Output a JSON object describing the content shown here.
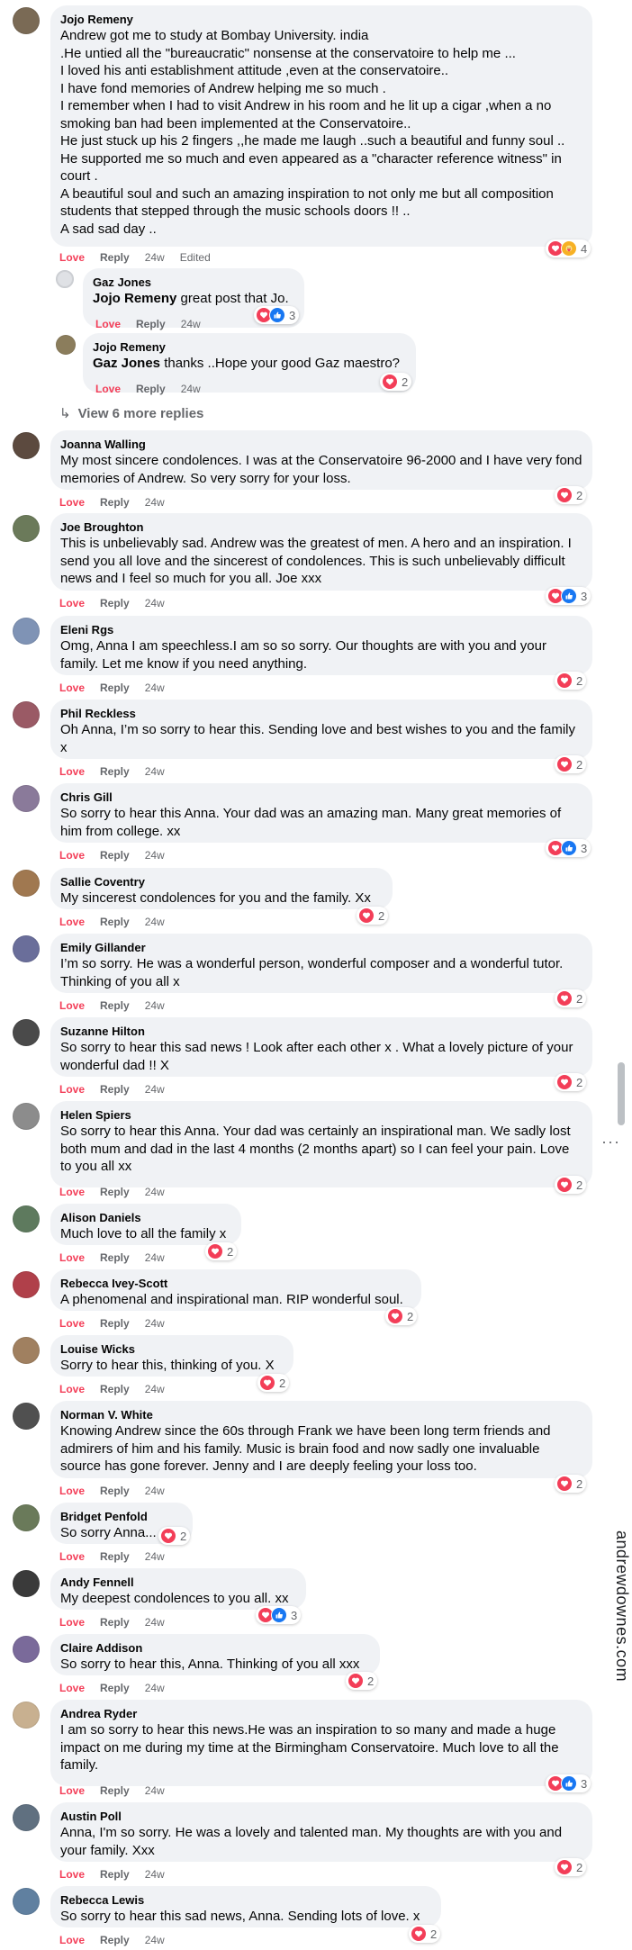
{
  "actions": {
    "love": "Love",
    "reply": "Reply"
  },
  "more_replies": "View 6 more replies",
  "watermark": "andrewdownes.com",
  "comments": [
    {
      "name": "Jojo Remeny",
      "text": "Andrew got me to study at Bombay University. india\n.He untied all the \"bureaucratic\" nonsense at the conservatoire to help me ...\nI loved his anti establishment attitude ,even at the conservatoire..\nI have fond memories of Andrew helping me so much .\nI remember when I had to visit Andrew in his room and he lit up a cigar ,when a no smoking ban had been implemented at the Conservatoire..\nHe just stuck up his 2 fingers ,,he made me laugh ..such a beautiful and funny soul ..\nHe supported me so much and even appeared as a \"character reference witness\" in court .\nA beautiful soul and such an amazing inspiration to not only me but all composition students that stepped through the music schools doors !! ..\nA sad sad day ..",
      "time": "24w",
      "edited": "Edited",
      "count": "4",
      "reactions": [
        "love",
        "care"
      ]
    },
    {
      "name": "Gaz Jones",
      "tag": "Jojo Remeny",
      "text": " great post that Jo.",
      "time": "24w",
      "count": "3",
      "reactions": [
        "love",
        "like"
      ]
    },
    {
      "name": "Jojo Remeny",
      "tag": "Gaz Jones",
      "text": " thanks ..Hope your good Gaz maestro?",
      "time": "24w",
      "count": "2",
      "reactions": [
        "love"
      ]
    },
    {
      "name": "Joanna Walling",
      "text": "My most sincere condolences. I was at the Conservatoire 96-2000 and I have very fond memories of Andrew. So very sorry for your loss.",
      "time": "24w",
      "count": "2",
      "reactions": [
        "love"
      ]
    },
    {
      "name": "Joe Broughton",
      "text": "This is unbelievably sad. Andrew was the greatest of men. A hero and an inspiration. I send you all love and the sincerest of condolences. This is such unbelievably difficult news and I feel so much for you all. Joe xxx",
      "time": "24w",
      "count": "3",
      "reactions": [
        "love",
        "like"
      ]
    },
    {
      "name": "Eleni Rgs",
      "text": "Omg, Anna I am speechless.I am so so sorry. Our thoughts are with you and your family. Let me know if you need anything.",
      "time": "24w",
      "count": "2",
      "reactions": [
        "love"
      ]
    },
    {
      "name": "Phil Reckless",
      "text": "Oh Anna, I’m so sorry to hear this. Sending love and best wishes to you and the family x",
      "time": "24w",
      "count": "2",
      "reactions": [
        "love"
      ]
    },
    {
      "name": "Chris Gill",
      "text": "So sorry to hear this Anna. Your dad was an amazing man. Many great memories of him from college. xx",
      "time": "24w",
      "count": "3",
      "reactions": [
        "love",
        "like"
      ]
    },
    {
      "name": "Sallie Coventry",
      "text": "My sincerest condolences for you and the family. Xx",
      "time": "24w",
      "count": "2",
      "reactions": [
        "love"
      ]
    },
    {
      "name": "Emily Gillander",
      "text": "I’m so sorry. He was a wonderful person, wonderful composer and a wonderful tutor. Thinking of you all x",
      "time": "24w",
      "count": "2",
      "reactions": [
        "love"
      ]
    },
    {
      "name": "Suzanne Hilton",
      "text": "So sorry to hear this sad news ! Look after each other x . What a lovely picture of your wonderful dad !! X",
      "time": "24w",
      "count": "2",
      "reactions": [
        "love"
      ]
    },
    {
      "name": "Helen Spiers",
      "text": "So sorry to hear this Anna. Your dad was certainly an inspirational man. We sadly lost both mum and dad in the last 4 months (2 months apart) so I can feel your pain. Love to you all xx",
      "time": "24w",
      "count": "2",
      "reactions": [
        "love"
      ]
    },
    {
      "name": "Alison Daniels",
      "text": "Much love to all the family x",
      "time": "24w",
      "count": "2",
      "reactions": [
        "love"
      ]
    },
    {
      "name": "Rebecca Ivey-Scott",
      "text": "A phenomenal and inspirational man. RIP wonderful soul.",
      "time": "24w",
      "count": "2",
      "reactions": [
        "love"
      ]
    },
    {
      "name": "Louise Wicks",
      "text": "Sorry to hear this, thinking of you. X",
      "time": "24w",
      "count": "2",
      "reactions": [
        "love"
      ]
    },
    {
      "name": "Norman V. White",
      "text": "Knowing Andrew since the 60s through Frank we have been long term friends and admirers of him and his family. Music is brain food and now sadly one invaluable source has gone forever. Jenny and I are deeply feeling your loss too.",
      "time": "24w",
      "count": "2",
      "reactions": [
        "love"
      ]
    },
    {
      "name": "Bridget Penfold",
      "text": "So sorry Anna...",
      "time": "24w",
      "count": "2",
      "reactions": [
        "love"
      ]
    },
    {
      "name": "Andy Fennell",
      "text": "My deepest condolences to you all. xx",
      "time": "24w",
      "count": "3",
      "reactions": [
        "love",
        "like"
      ]
    },
    {
      "name": "Claire Addison",
      "text": "So sorry to hear this, Anna. Thinking of you all xxx",
      "time": "24w",
      "count": "2",
      "reactions": [
        "love"
      ]
    },
    {
      "name": "Andrea Ryder",
      "text": "I am so sorry to hear this news.He was an inspiration to so many and made a huge impact on me during my time at the Birmingham Conservatoire. Much love to all the family.",
      "time": "24w",
      "count": "3",
      "reactions": [
        "love",
        "like"
      ]
    },
    {
      "name": "Austin Poll",
      "text": "Anna, I'm so sorry. He was a lovely and talented man. My thoughts are with you and your family. Xxx",
      "time": "24w",
      "count": "2",
      "reactions": [
        "love"
      ]
    },
    {
      "name": "Rebecca Lewis",
      "text": "So sorry to hear this sad news, Anna. Sending lots of love. x",
      "time": "24w",
      "count": "2",
      "reactions": [
        "love"
      ]
    }
  ]
}
